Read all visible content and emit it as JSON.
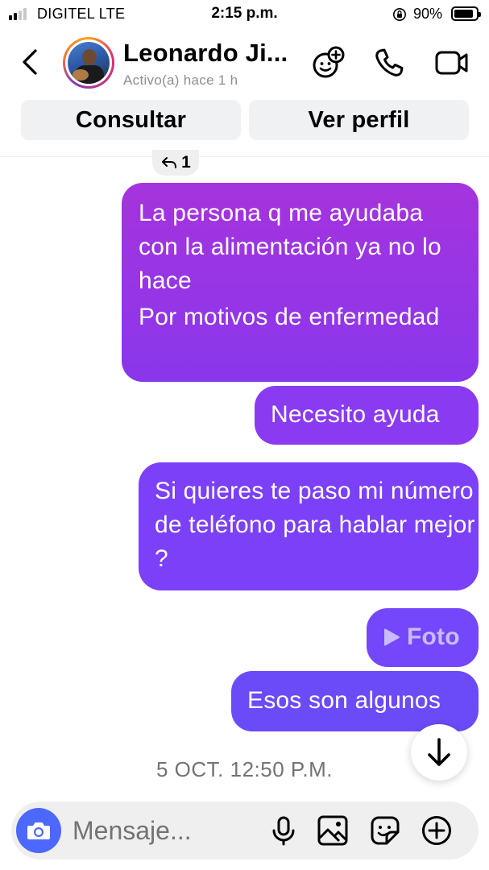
{
  "status_bar": {
    "carrier": "DIGITEL   LTE",
    "time": "2:15 p.m.",
    "battery": "90%",
    "battery_level": 0.9,
    "signal_bars": 2
  },
  "header": {
    "contact_name": "Leonardo Ji...",
    "contact_status": "Activo(a) hace 1 h",
    "icons": [
      "back-icon",
      "effects-icon",
      "phone-call-icon",
      "video-call-icon"
    ]
  },
  "actions": {
    "consult_label": "Consultar",
    "profile_label": "Ver perfil"
  },
  "reply_indicator": {
    "count": "1"
  },
  "messages": [
    {
      "lines": [
        "La persona q me ayudaba con la alimentación ya no lo hace",
        "Por motivos de enfermedad"
      ]
    },
    {
      "text": "Necesito ayuda"
    },
    {
      "text": "Si quieres te paso mi número de teléfono para hablar mejor ?"
    },
    {
      "text": "Foto",
      "icon": "play-icon"
    },
    {
      "text": "Esos son algunos"
    }
  ],
  "date_separator": "5 OCT. 12:50 P.M.",
  "composer": {
    "placeholder": "Mensaje...",
    "icons": [
      "camera-icon",
      "microphone-icon",
      "gallery-icon",
      "sticker-icon",
      "plus-icon"
    ]
  },
  "colors": {
    "accent_blue": "#4c68ff",
    "bubble_top": "#a534dd",
    "bubble_bottom": "#6b4af8",
    "muted_text": "#737373"
  }
}
